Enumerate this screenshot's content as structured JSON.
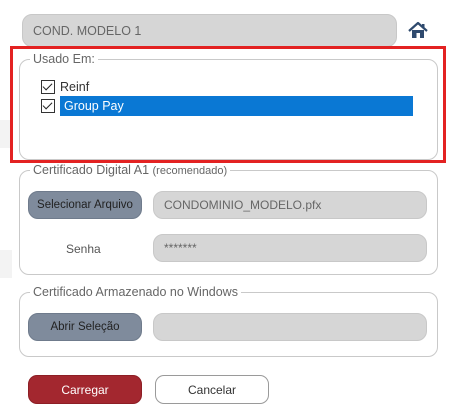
{
  "model_name": "COND. MODELO 1",
  "usado_em": {
    "legend": "Usado Em:",
    "items": [
      {
        "label": "Reinf",
        "checked": true,
        "selected": false
      },
      {
        "label": "Group Pay",
        "checked": true,
        "selected": true
      }
    ]
  },
  "cert_a1": {
    "legend": "Certificado Digital A1",
    "legend_note": "(recomendado)",
    "select_button": "Selecionar Arquivo",
    "file_value": "CONDOMINIO_MODELO.pfx",
    "password_label": "Senha",
    "password_value": "*******"
  },
  "cert_windows": {
    "legend": "Certificado Armazenado no Windows",
    "open_button": "Abrir Seleção",
    "selection_value": ""
  },
  "actions": {
    "load": "Carregar",
    "cancel": "Cancelar"
  },
  "colors": {
    "highlight": "#e32222",
    "selection": "#0a78d4",
    "primary": "#a3272f",
    "secondary": "#7f8b9c"
  }
}
